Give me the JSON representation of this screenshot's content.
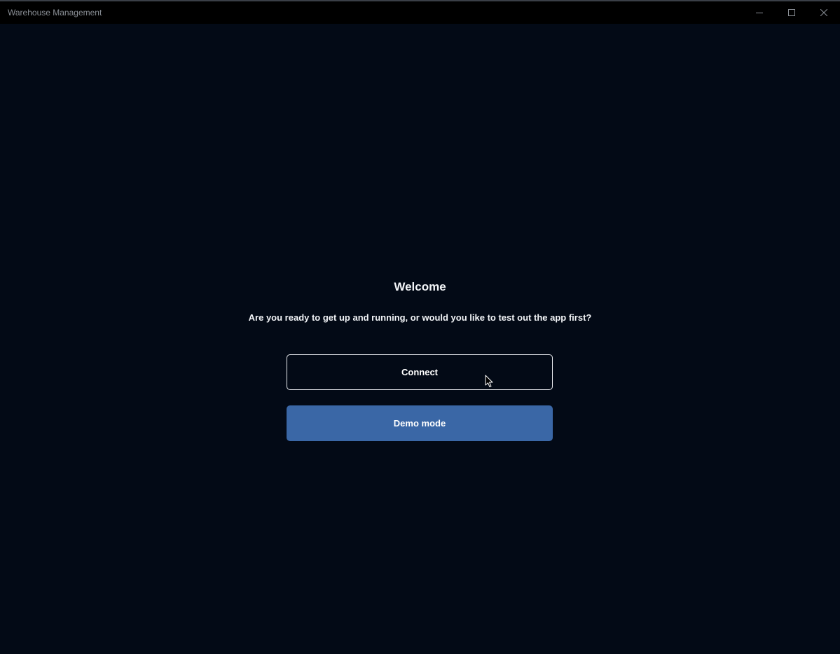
{
  "window": {
    "title": "Warehouse Management"
  },
  "icons": {
    "minimize": "minimize-icon",
    "maximize": "maximize-icon",
    "close": "close-icon",
    "cursor": "mouse-pointer-icon"
  },
  "welcome": {
    "title": "Welcome",
    "subtitle": "Are you ready to get up and running, or would you like to test out the app first?",
    "connect_label": "Connect",
    "demo_label": "Demo mode"
  },
  "colors": {
    "background": "#030a16",
    "titlebar": "#000000",
    "accent": "#3a67a6",
    "text": "#f2f4f7"
  }
}
